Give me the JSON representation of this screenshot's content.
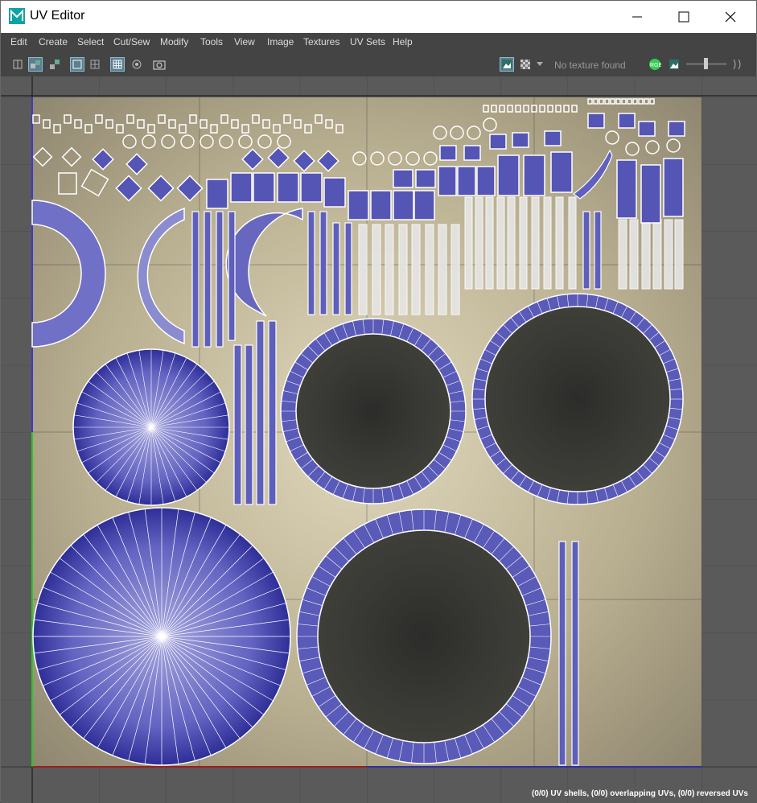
{
  "window": {
    "title": "UV Editor"
  },
  "menu": [
    "Edit",
    "Create",
    "Select",
    "Cut/Sew",
    "Modify",
    "Tools",
    "View",
    "Image",
    "Textures",
    "UV Sets",
    "Help"
  ],
  "toolbar": {
    "texture_status": "No texture found"
  },
  "status": {
    "text": "(0/0) UV shells, (0/0) overlapping UVs, (0/0) reversed UVs"
  },
  "colors": {
    "accent": "#5a7f8f",
    "uv_shell": "#6e6fc1",
    "uv_shell_dark": "#2b2b8a",
    "texture_bg": "#c9c1a3"
  },
  "icons": {
    "app": "maya-icon",
    "minimize": "minimize-icon",
    "maximize": "maximize-icon",
    "close": "close-icon"
  }
}
